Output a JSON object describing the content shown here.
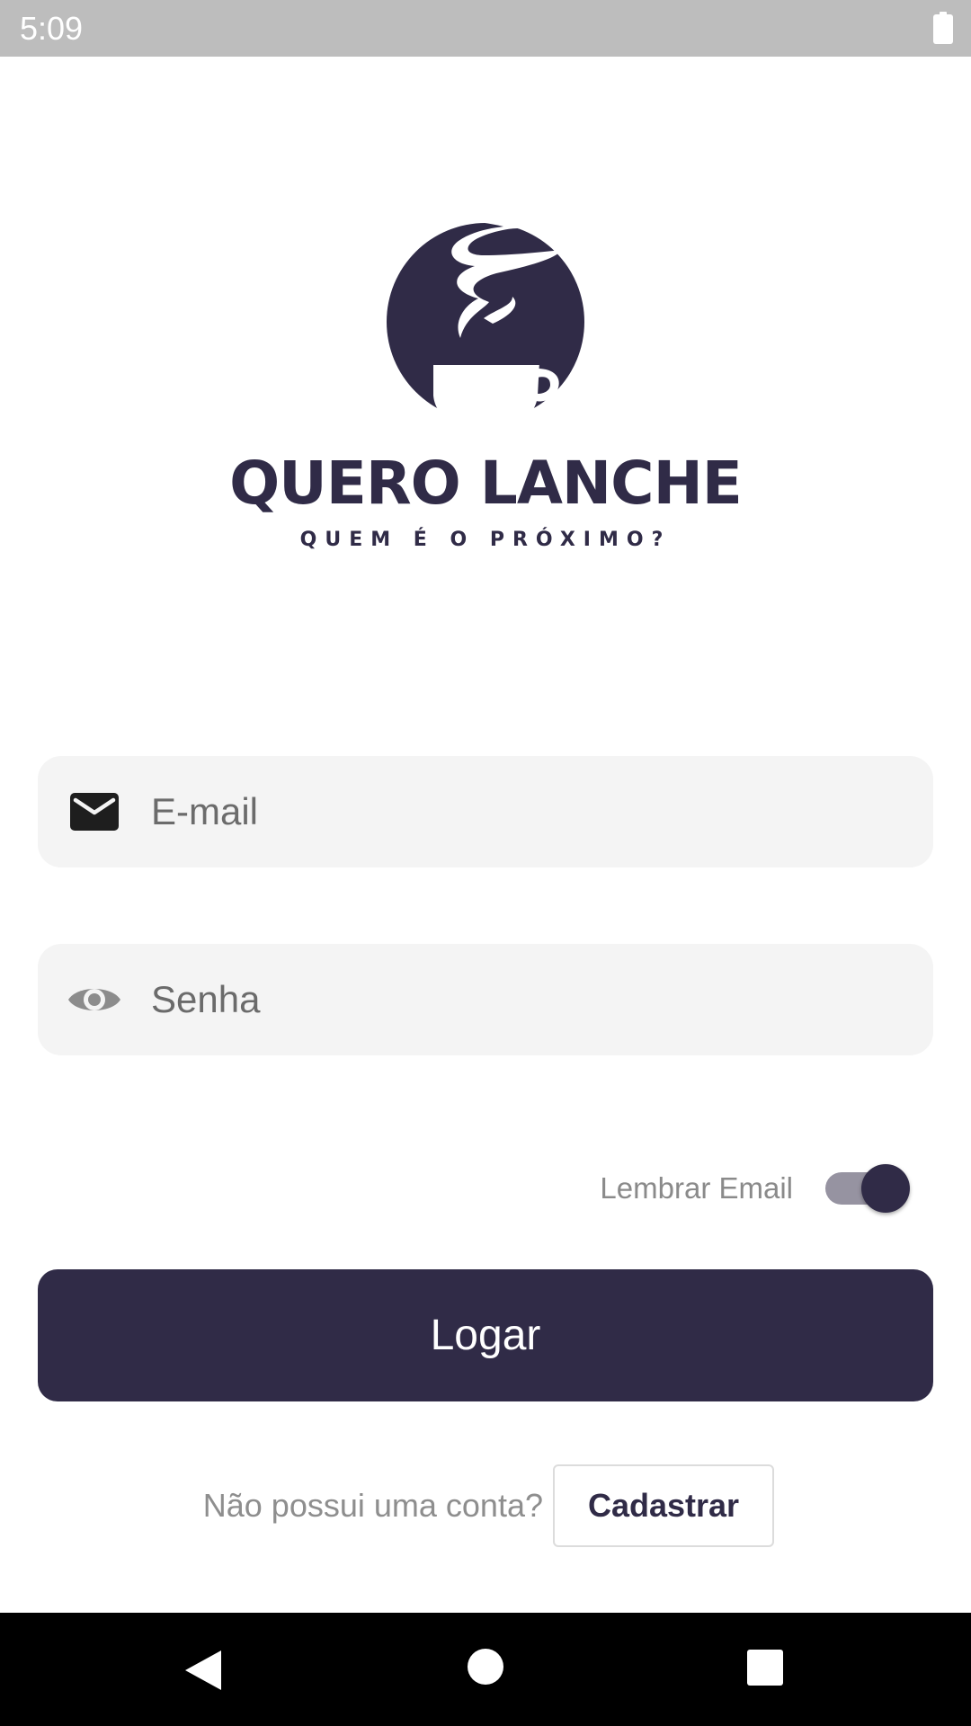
{
  "status_bar": {
    "time": "5:09",
    "battery_icon": "battery-full-icon",
    "background_color": "#bdbdbd"
  },
  "logo": {
    "brand_name": "QUERO LANCHE",
    "tagline": "QUEM É O PRÓXIMO?",
    "icon": "coffee-cup-logo",
    "color": "#302b47"
  },
  "login_form": {
    "email": {
      "placeholder": "E-mail",
      "value": "",
      "icon": "mail-icon"
    },
    "password": {
      "placeholder": "Senha",
      "value": "",
      "icon": "eye-icon"
    },
    "remember": {
      "label": "Lembrar Email",
      "checked": true
    },
    "submit_label": "Logar"
  },
  "signup": {
    "question": "Não possui uma conta?",
    "button_label": "Cadastrar"
  },
  "nav_bar": {
    "back_icon": "back-triangle-icon",
    "home_icon": "home-circle-icon",
    "recents_icon": "recents-square-icon"
  },
  "colors": {
    "primary": "#302b47",
    "field_background": "#f4f4f4",
    "toggle_track": "#9693a1"
  }
}
